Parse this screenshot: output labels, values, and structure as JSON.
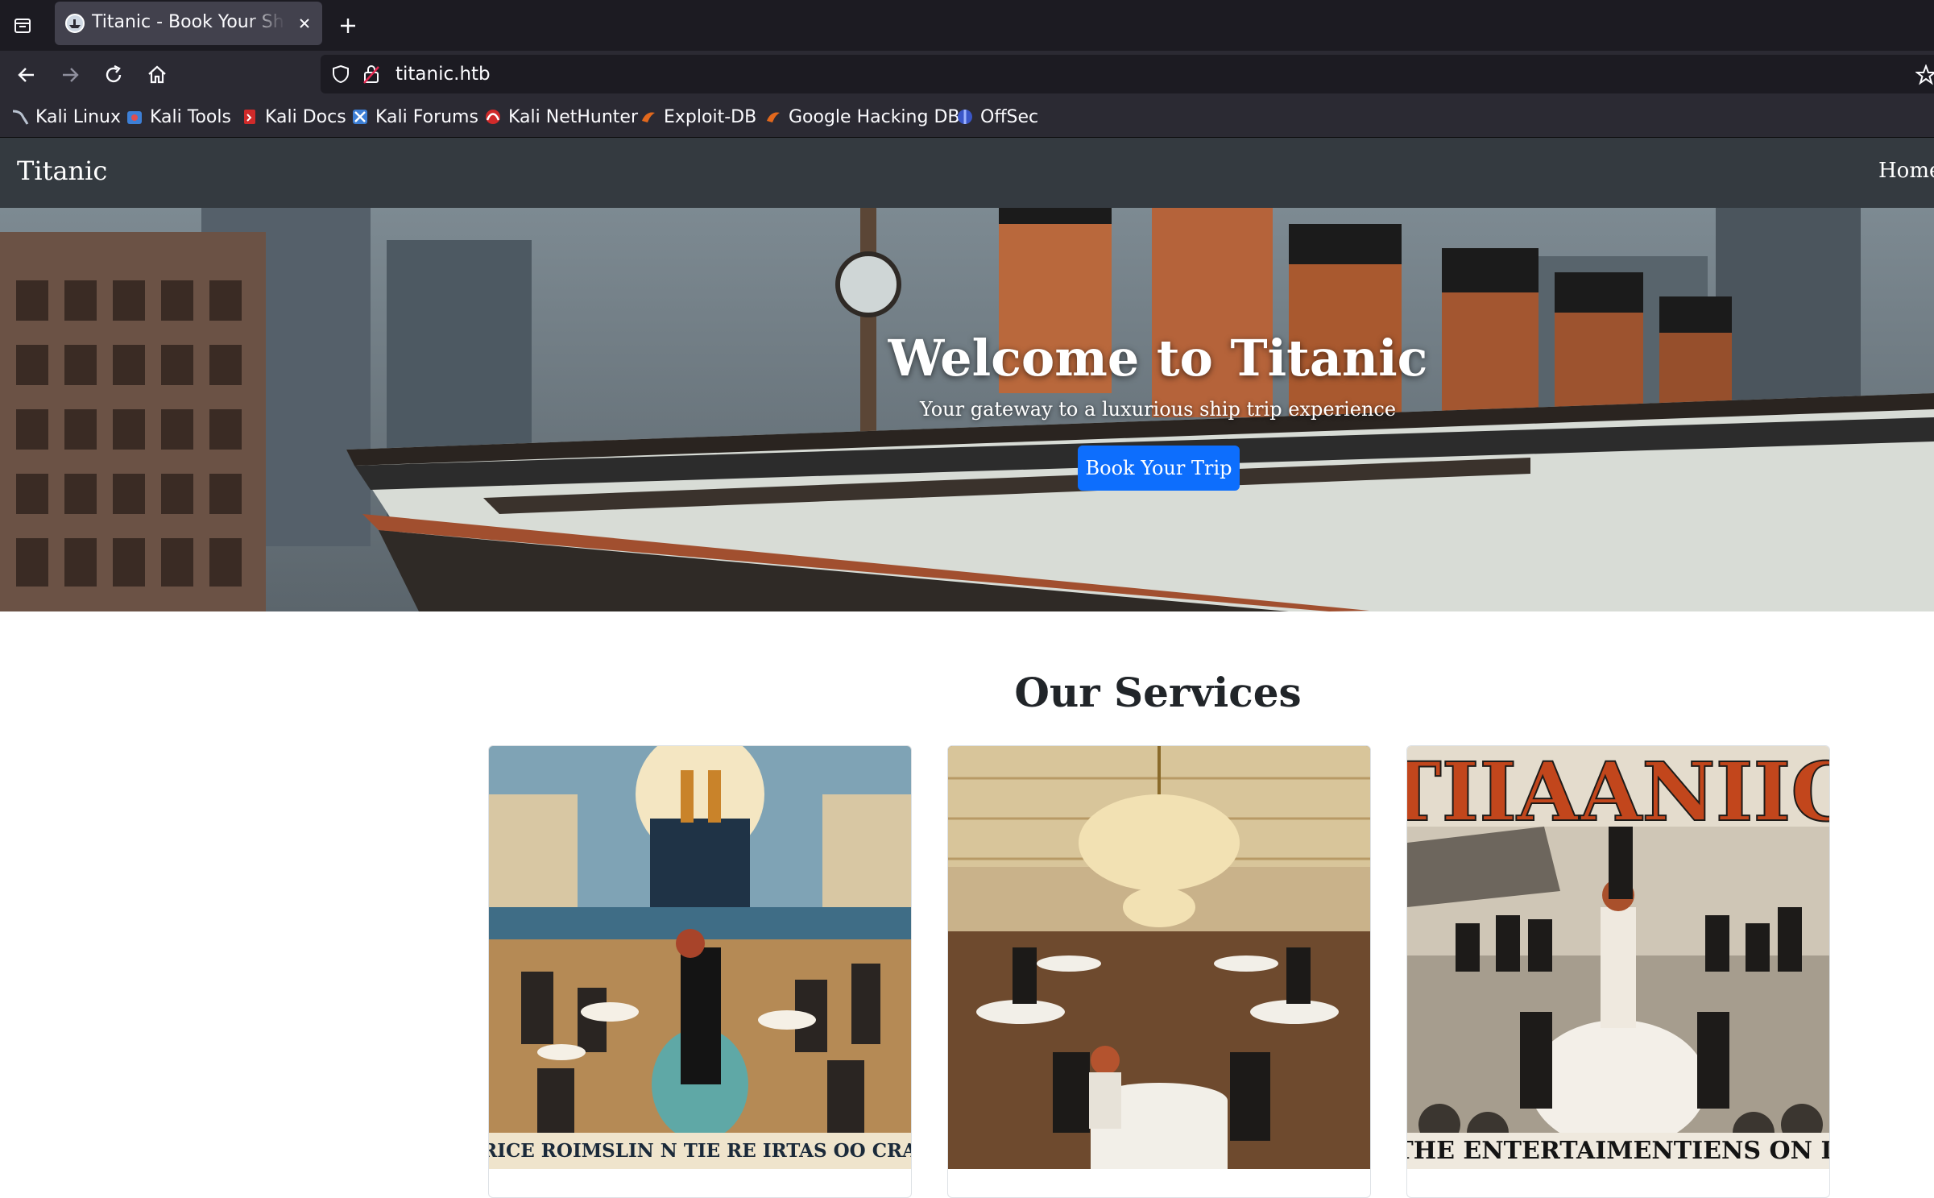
{
  "browser": {
    "tab_title": "Titanic - Book Your Ship T",
    "url": "titanic.htb",
    "bookmarks": [
      {
        "label": "Kali Linux",
        "icon": "kali-dragon-icon"
      },
      {
        "label": "Kali Tools",
        "icon": "kali-tools-icon"
      },
      {
        "label": "Kali Docs",
        "icon": "kali-docs-icon"
      },
      {
        "label": "Kali Forums",
        "icon": "kali-forums-icon"
      },
      {
        "label": "Kali NetHunter",
        "icon": "kali-nethunter-icon"
      },
      {
        "label": "Exploit-DB",
        "icon": "exploit-db-icon"
      },
      {
        "label": "Google Hacking DB",
        "icon": "ghdb-icon"
      },
      {
        "label": "OffSec",
        "icon": "offsec-icon"
      }
    ]
  },
  "site": {
    "brand": "Titanic",
    "nav_home": "Home",
    "hero": {
      "title": "Welcome to Titanic",
      "subtitle": "Your gateway to a luxurious ship trip experience",
      "cta": "Book Your Trip"
    },
    "services_title": "Our Services",
    "cards": [
      {
        "image": "dining-dance-poster",
        "banner": "TTRICE ROIMSLIN N TIE RE IRTAS OO CRAS I"
      },
      {
        "image": "grand-dining-hall-image",
        "banner": ""
      },
      {
        "image": "entertainment-poster",
        "poster_title": "TIIAANIIC",
        "banner": "E THE ENTERTAIMENTIENS ON LAI"
      }
    ]
  },
  "colors": {
    "nav_bg": "#343a40",
    "primary": "#0d6efd",
    "browser_tabbar": "#1c1b22",
    "browser_toolbar": "#2b2a33"
  }
}
